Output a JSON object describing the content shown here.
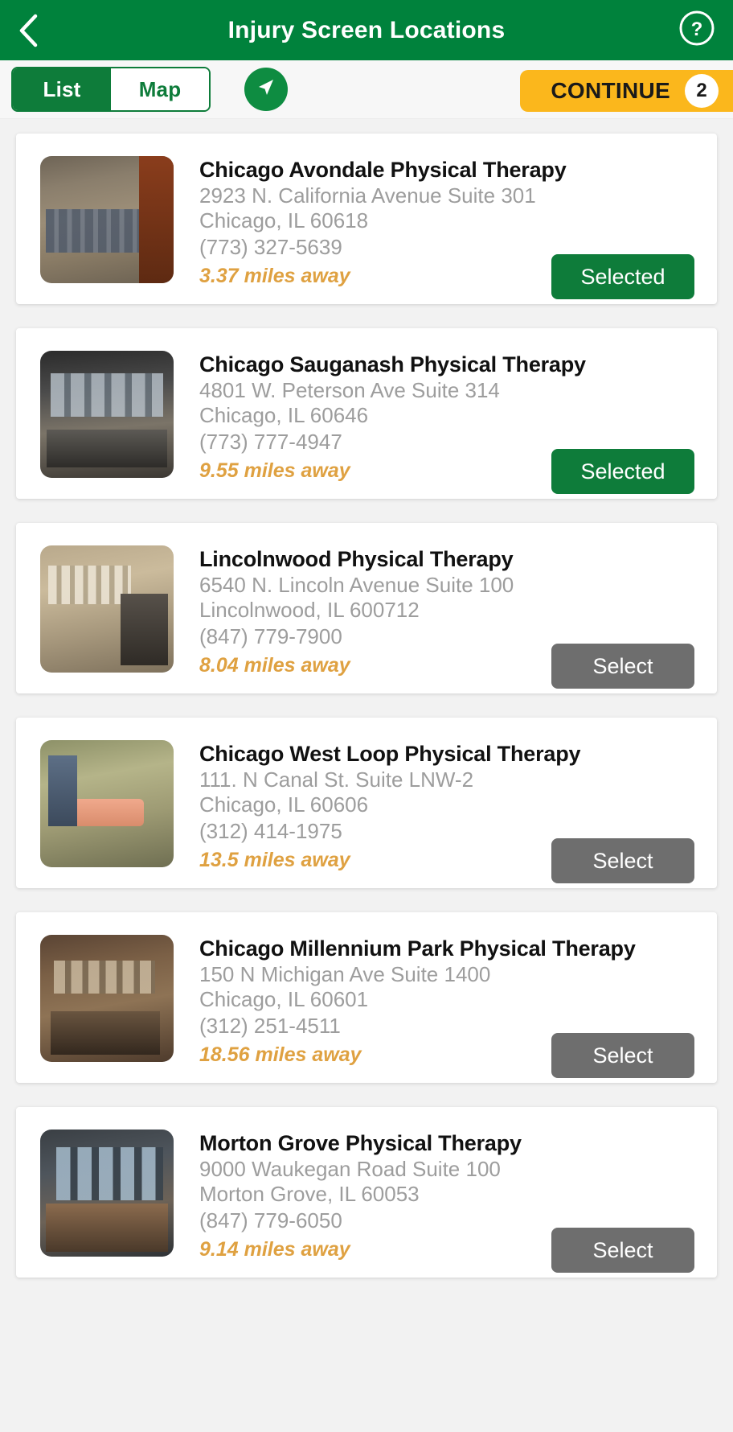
{
  "header": {
    "title": "Injury Screen Locations",
    "back_icon": "chevron-left-icon",
    "help_icon": "question-circle-icon",
    "background_color": "#00823C"
  },
  "toolbar": {
    "segments": [
      {
        "label": "List",
        "active": true
      },
      {
        "label": "Map",
        "active": false
      }
    ],
    "locate_icon": "navigation-arrow-icon",
    "continue": {
      "label": "CONTINUE",
      "count": "2",
      "background_color": "#FBB71C"
    }
  },
  "colors": {
    "brand_green": "#0E7C3A",
    "amber": "#FBB71C",
    "distance_orange": "#DFA141",
    "select_gray": "#6E6E6E"
  },
  "locations": [
    {
      "name": "Chicago Avondale Physical Therapy",
      "address": "2923 N. California Avenue Suite 301",
      "city_state_zip": "Chicago, IL 60618",
      "phone": "(773) 327-5639",
      "distance": "3.37 miles away",
      "action_label": "Selected",
      "selected": true
    },
    {
      "name": "Chicago Sauganash Physical Therapy",
      "address": "4801 W. Peterson Ave Suite 314",
      "city_state_zip": "Chicago, IL 60646",
      "phone": "(773) 777-4947",
      "distance": "9.55 miles away",
      "action_label": "Selected",
      "selected": true
    },
    {
      "name": "Lincolnwood Physical Therapy",
      "address": "6540 N. Lincoln Avenue Suite 100",
      "city_state_zip": "Lincolnwood, IL 600712",
      "phone": "(847) 779-7900",
      "distance": "8.04 miles away",
      "action_label": "Select",
      "selected": false
    },
    {
      "name": "Chicago West Loop Physical Therapy",
      "address": "111. N Canal St. Suite LNW-2",
      "city_state_zip": "Chicago, IL 60606",
      "phone": "(312) 414-1975",
      "distance": "13.5 miles away",
      "action_label": "Select",
      "selected": false
    },
    {
      "name": "Chicago Millennium Park Physical Therapy",
      "address": "150 N Michigan Ave Suite 1400",
      "city_state_zip": "Chicago, IL 60601",
      "phone": "(312) 251-4511",
      "distance": "18.56 miles away",
      "action_label": "Select",
      "selected": false
    },
    {
      "name": "Morton Grove Physical Therapy",
      "address": "9000 Waukegan Road Suite 100",
      "city_state_zip": "Morton Grove, IL 60053",
      "phone": "(847) 779-6050",
      "distance": "9.14 miles away",
      "action_label": "Select",
      "selected": false
    }
  ]
}
